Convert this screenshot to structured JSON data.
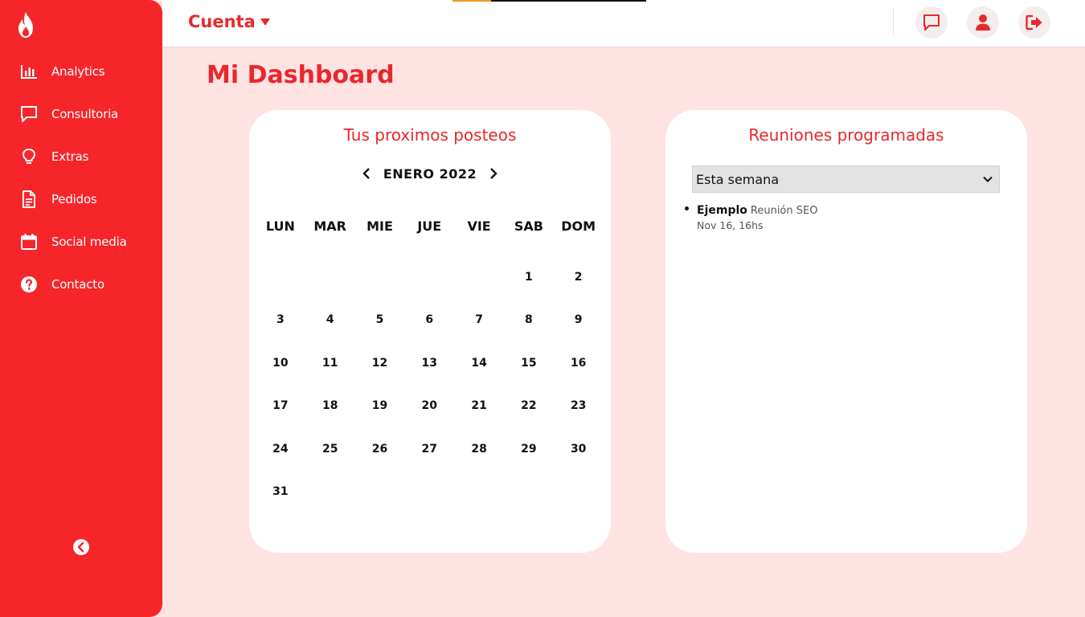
{
  "sidebar": {
    "items": [
      {
        "label": "Analytics"
      },
      {
        "label": "Consultoria"
      },
      {
        "label": "Extras"
      },
      {
        "label": "Pedidos"
      },
      {
        "label": "Social media"
      },
      {
        "label": "Contacto"
      }
    ]
  },
  "topbar": {
    "account_label": "Cuenta",
    "progress": 0.2
  },
  "main": {
    "title": "Mi Dashboard"
  },
  "calendar": {
    "title": "Tus proximos posteos",
    "month_label": "ENERO 2022",
    "weekdays": [
      "LUN",
      "MAR",
      "MIE",
      "JUE",
      "VIE",
      "SAB",
      "DOM"
    ],
    "weeks": [
      [
        "",
        "",
        "",
        "",
        "",
        "1",
        "2"
      ],
      [
        "3",
        "4",
        "5",
        "6",
        "7",
        "8",
        "9"
      ],
      [
        "10",
        "11",
        "12",
        "13",
        "14",
        "15",
        "16"
      ],
      [
        "17",
        "18",
        "19",
        "20",
        "21",
        "22",
        "23"
      ],
      [
        "24",
        "25",
        "26",
        "27",
        "28",
        "29",
        "30"
      ],
      [
        "31",
        "",
        "",
        "",
        "",
        "",
        ""
      ]
    ]
  },
  "meetings": {
    "title": "Reuniones programadas",
    "filter": {
      "selected": "Esta semana"
    },
    "items": [
      {
        "name": "Ejemplo",
        "topic": "Reunión SEO",
        "time": "Nov 16, 16hs"
      }
    ]
  },
  "colors": {
    "brand": "#f6252a",
    "accent_text": "#e8282d",
    "page_bg": "#ffe3e3"
  }
}
